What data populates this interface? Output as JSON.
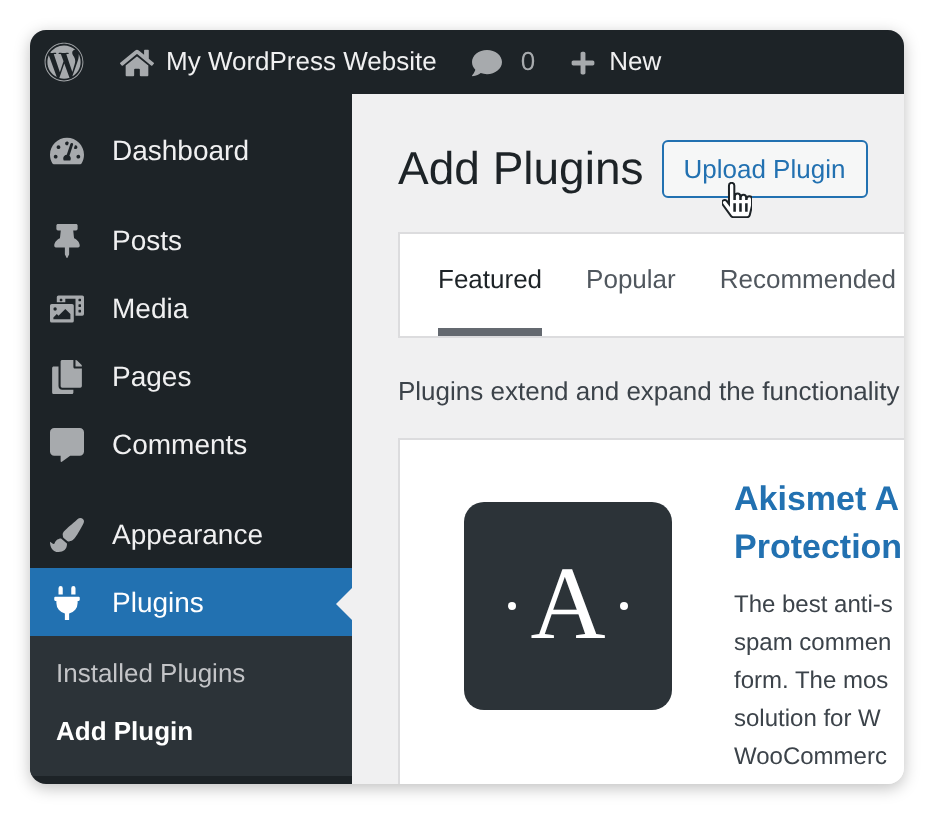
{
  "admin_bar": {
    "site_name": "My WordPress Website",
    "comment_count": "0",
    "new_label": "New"
  },
  "sidebar": {
    "groups": [
      [
        {
          "label": "Dashboard",
          "selected": false
        }
      ],
      [
        {
          "label": "Posts",
          "selected": false
        },
        {
          "label": "Media",
          "selected": false
        },
        {
          "label": "Pages",
          "selected": false
        },
        {
          "label": "Comments",
          "selected": false
        }
      ],
      [
        {
          "label": "Appearance",
          "selected": false
        },
        {
          "label": "Plugins",
          "selected": true,
          "children": [
            {
              "label": "Installed Plugins",
              "selected": false
            },
            {
              "label": "Add Plugin",
              "selected": true
            }
          ]
        }
      ]
    ]
  },
  "page": {
    "title": "Add Plugins",
    "upload_button": "Upload Plugin",
    "tabs": [
      {
        "label": "Featured",
        "selected": true
      },
      {
        "label": "Popular",
        "selected": false
      },
      {
        "label": "Recommended",
        "selected": false
      }
    ],
    "intro": "Plugins extend and expand the functionality",
    "plugin_card": {
      "logo_letter": "A",
      "title_lines": [
        "Akismet A",
        "Protection"
      ],
      "description_lines": [
        "The best anti-s",
        "spam commen",
        "form. The mos",
        "solution for W",
        "WooCommerc"
      ]
    }
  }
}
